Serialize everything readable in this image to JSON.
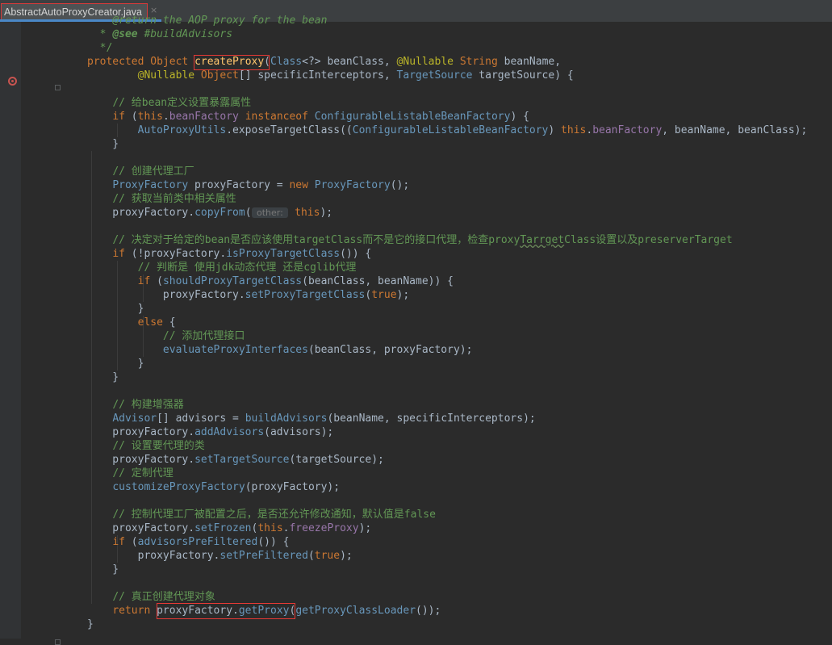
{
  "tab": {
    "filename": "AbstractAutoProxyCreator.java",
    "close_glyph": "×"
  },
  "code": {
    "lines": [
      [
        [
          "    ",
          ""
        ],
        [
          "@return the AOP proxy for the bean",
          "cmi"
        ]
      ],
      [
        [
          "  * ",
          "cm"
        ],
        [
          "@see",
          "jtag"
        ],
        [
          " #buildAdvisors",
          "cmi"
        ]
      ],
      [
        [
          "  */",
          "cm"
        ]
      ],
      [
        [
          "protected ",
          "kw"
        ],
        [
          "Object ",
          "kw"
        ],
        [
          "createProxy",
          "meth"
        ],
        [
          "(",
          ""
        ],
        [
          "Class",
          "typ"
        ],
        [
          "<?> beanClass, ",
          ""
        ],
        [
          "@Nullable",
          "anno"
        ],
        [
          " ",
          ""
        ],
        [
          "String",
          "kw"
        ],
        [
          " beanName,",
          ""
        ]
      ],
      [
        [
          "        ",
          ""
        ],
        [
          "@Nullable",
          "anno"
        ],
        [
          " ",
          ""
        ],
        [
          "Object",
          "kw"
        ],
        [
          "[] specificInterceptors, ",
          ""
        ],
        [
          "TargetSource",
          "typ"
        ],
        [
          " targetSource) {",
          ""
        ]
      ],
      [],
      [
        [
          "    ",
          ""
        ],
        [
          "// 给bean定义设置暴露属性",
          "cm"
        ]
      ],
      [
        [
          "    ",
          ""
        ],
        [
          "if",
          "kw"
        ],
        [
          " (",
          ""
        ],
        [
          "this",
          "kw"
        ],
        [
          ".",
          ""
        ],
        [
          "beanFactory",
          "fld"
        ],
        [
          " ",
          ""
        ],
        [
          "instanceof",
          "kw"
        ],
        [
          " ",
          ""
        ],
        [
          "ConfigurableListableBeanFactory",
          "typ"
        ],
        [
          ") {",
          ""
        ]
      ],
      [
        [
          "        ",
          ""
        ],
        [
          "AutoProxyUtils",
          "typ"
        ],
        [
          ".exposeTargetClass((",
          ""
        ],
        [
          "ConfigurableListableBeanFactory",
          "typ"
        ],
        [
          ") ",
          ""
        ],
        [
          "this",
          "kw"
        ],
        [
          ".",
          ""
        ],
        [
          "beanFactory",
          "fld"
        ],
        [
          ", beanName, beanClass);",
          ""
        ]
      ],
      [
        [
          "    }",
          ""
        ]
      ],
      [],
      [
        [
          "    ",
          ""
        ],
        [
          "// 创建代理工厂",
          "cm"
        ]
      ],
      [
        [
          "    ",
          ""
        ],
        [
          "ProxyFactory",
          "typ"
        ],
        [
          " proxyFactory = ",
          ""
        ],
        [
          "new",
          "kw"
        ],
        [
          " ",
          ""
        ],
        [
          "ProxyFactory",
          "typ"
        ],
        [
          "();",
          ""
        ]
      ],
      [
        [
          "    ",
          ""
        ],
        [
          "// 获取当前类中相关属性",
          "cm"
        ]
      ],
      [
        [
          "    proxyFactory.",
          ""
        ],
        [
          "copyFrom",
          "mcall"
        ],
        [
          "(",
          ""
        ],
        [
          " other: ",
          "hint"
        ],
        [
          " ",
          ""
        ],
        [
          "this",
          "kw"
        ],
        [
          ");",
          ""
        ]
      ],
      [],
      [
        [
          "    ",
          ""
        ],
        [
          "// 决定对于给定的bean是否应该使用targetClass而不是它的接口代理，检查proxy",
          "cm"
        ],
        [
          "Tarrget",
          "cm wavy"
        ],
        [
          "Class设置以及preserverTarget",
          "cm"
        ]
      ],
      [
        [
          "    ",
          ""
        ],
        [
          "if",
          "kw"
        ],
        [
          " (!proxyFactory.",
          ""
        ],
        [
          "isProxyTargetClass",
          "mcall"
        ],
        [
          "()) {",
          ""
        ]
      ],
      [
        [
          "        ",
          ""
        ],
        [
          "// 判断是 使用jdk动态代理 还是cglib代理",
          "cm"
        ]
      ],
      [
        [
          "        ",
          ""
        ],
        [
          "if",
          "kw"
        ],
        [
          " (",
          ""
        ],
        [
          "shouldProxyTargetClass",
          "mcall"
        ],
        [
          "(beanClass, beanName)) {",
          ""
        ]
      ],
      [
        [
          "            proxyFactory.",
          ""
        ],
        [
          "setProxyTargetClass",
          "mcall"
        ],
        [
          "(",
          ""
        ],
        [
          "true",
          "kw"
        ],
        [
          ");",
          ""
        ]
      ],
      [
        [
          "        }",
          ""
        ]
      ],
      [
        [
          "        ",
          ""
        ],
        [
          "else",
          "kw"
        ],
        [
          " {",
          ""
        ]
      ],
      [
        [
          "            ",
          ""
        ],
        [
          "// 添加代理接口",
          "cm"
        ]
      ],
      [
        [
          "            ",
          ""
        ],
        [
          "evaluateProxyInterfaces",
          "mcall"
        ],
        [
          "(beanClass, proxyFactory);",
          ""
        ]
      ],
      [
        [
          "        }",
          ""
        ]
      ],
      [
        [
          "    }",
          ""
        ]
      ],
      [],
      [
        [
          "    ",
          ""
        ],
        [
          "// 构建增强器",
          "cm"
        ]
      ],
      [
        [
          "    ",
          ""
        ],
        [
          "Advisor",
          "typ"
        ],
        [
          "[] advisors = ",
          ""
        ],
        [
          "buildAdvisors",
          "mcall"
        ],
        [
          "(beanName, specificInterceptors);",
          ""
        ]
      ],
      [
        [
          "    proxyFactory.",
          ""
        ],
        [
          "addAdvisors",
          "mcall"
        ],
        [
          "(advisors);",
          ""
        ]
      ],
      [
        [
          "    ",
          ""
        ],
        [
          "// 设置要代理的类",
          "cm"
        ]
      ],
      [
        [
          "    proxyFactory.",
          ""
        ],
        [
          "setTargetSource",
          "mcall"
        ],
        [
          "(targetSource);",
          ""
        ]
      ],
      [
        [
          "    ",
          ""
        ],
        [
          "// 定制代理",
          "cm"
        ]
      ],
      [
        [
          "    ",
          ""
        ],
        [
          "customizeProxyFactory",
          "mcall"
        ],
        [
          "(proxyFactory);",
          ""
        ]
      ],
      [],
      [
        [
          "    ",
          ""
        ],
        [
          "// 控制代理工厂被配置之后，是否还允许修改通知，默认值是false",
          "cm"
        ]
      ],
      [
        [
          "    proxyFactory.",
          ""
        ],
        [
          "setFrozen",
          "mcall"
        ],
        [
          "(",
          ""
        ],
        [
          "this",
          "kw"
        ],
        [
          ".",
          ""
        ],
        [
          "freezeProxy",
          "fld"
        ],
        [
          ");",
          ""
        ]
      ],
      [
        [
          "    ",
          ""
        ],
        [
          "if",
          "kw"
        ],
        [
          " (",
          ""
        ],
        [
          "advisorsPreFiltered",
          "mcall"
        ],
        [
          "()) {",
          ""
        ]
      ],
      [
        [
          "        proxyFactory.",
          ""
        ],
        [
          "setPreFiltered",
          "mcall"
        ],
        [
          "(",
          ""
        ],
        [
          "true",
          "kw"
        ],
        [
          ");",
          ""
        ]
      ],
      [
        [
          "    }",
          ""
        ]
      ],
      [],
      [
        [
          "    ",
          ""
        ],
        [
          "// 真正创建代理对象",
          "cm"
        ]
      ],
      [
        [
          "    ",
          ""
        ],
        [
          "return",
          "kw"
        ],
        [
          " proxyFactory.",
          ""
        ],
        [
          "getProxy",
          "mcall"
        ],
        [
          "(",
          ""
        ],
        [
          "getProxyClassLoader",
          "mcall"
        ],
        [
          "());",
          ""
        ]
      ],
      [
        [
          "}",
          ""
        ]
      ]
    ]
  }
}
